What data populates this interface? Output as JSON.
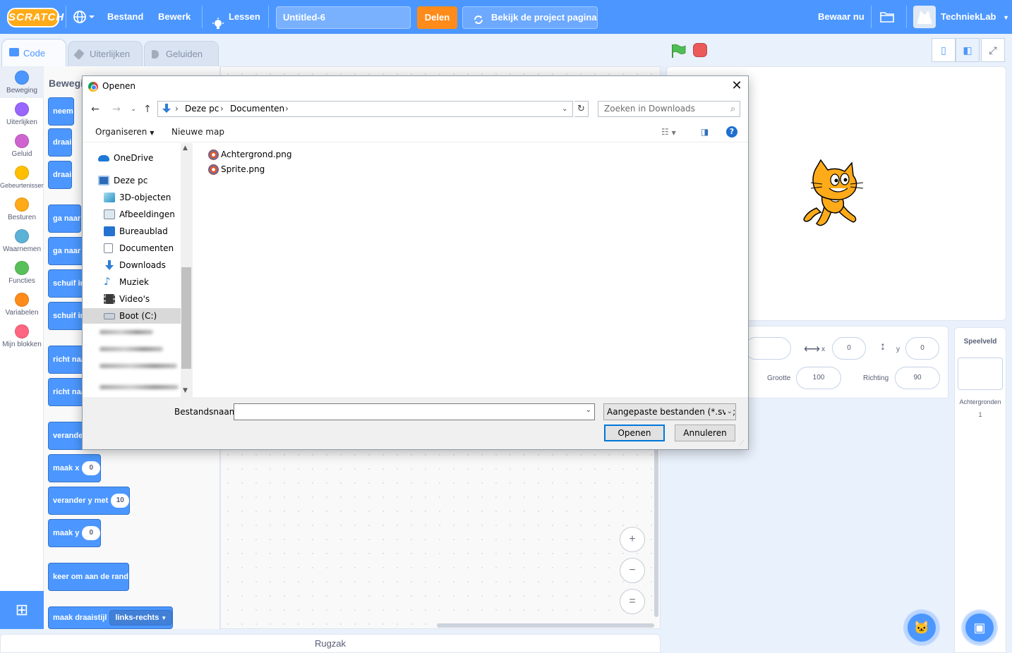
{
  "menubar": {
    "logo": "SCRATCH",
    "file": "Bestand",
    "edit": "Bewerk",
    "tutorials": "Lessen",
    "project_title": "Untitled-6",
    "share": "Delen",
    "see_project": "Bekijk de project pagina",
    "save_now": "Bewaar nu",
    "username": "TechniekLab"
  },
  "tabs": {
    "code": "Code",
    "costumes": "Uiterlijken",
    "sounds": "Geluiden"
  },
  "categories": [
    {
      "label": "Beweging",
      "color": "#4c97ff"
    },
    {
      "label": "Uiterlijken",
      "color": "#9966ff"
    },
    {
      "label": "Geluid",
      "color": "#cf63cf"
    },
    {
      "label": "Gebeurtenissen",
      "color": "#ffbf00"
    },
    {
      "label": "Besturen",
      "color": "#ffab19"
    },
    {
      "label": "Waarnemen",
      "color": "#5cb1d6"
    },
    {
      "label": "Functies",
      "color": "#59c059"
    },
    {
      "label": "Variabelen",
      "color": "#ff8c1a"
    },
    {
      "label": "Mijn blokken",
      "color": "#ff6680"
    }
  ],
  "flyout": {
    "title": "Bewegi",
    "blocks": [
      {
        "text": "neem",
        "slot": ""
      },
      {
        "text": "draai",
        "slot": ""
      },
      {
        "text": "draai",
        "slot": ""
      },
      {
        "text": "ga naar",
        "slot": ""
      },
      {
        "text": "ga naar x",
        "slot": ""
      },
      {
        "text": "schuif in",
        "slot": ""
      },
      {
        "text": "schuif in",
        "slot": ""
      },
      {
        "text": "richt naa",
        "slot": ""
      },
      {
        "text": "richt naa",
        "slot": ""
      },
      {
        "text": "verander",
        "slot": ""
      },
      {
        "text": "maak x",
        "slot": "0"
      },
      {
        "text": "verander y met",
        "slot": "10"
      },
      {
        "text": "maak y",
        "slot": "0"
      },
      {
        "text": "keer om aan de rand",
        "slot": ""
      },
      {
        "text": "maak draaistijl",
        "dropdown": "links-rechts"
      }
    ]
  },
  "workspace": {
    "zoom_in": "+",
    "zoom_out": "−",
    "zoom_reset": "="
  },
  "backpack": "Rugzak",
  "sprite_info": {
    "x_label": "x",
    "x_value": "0",
    "y_label": "y",
    "y_value": "0",
    "size_label": "Grootte",
    "size_value": "100",
    "direction_label": "Richting",
    "direction_value": "90"
  },
  "stage_target": {
    "title": "Speelveld",
    "backdrops_label": "Achtergronden",
    "backdrops_count": "1"
  },
  "dialog": {
    "title": "Openen",
    "address": [
      "Deze pc",
      "Documenten"
    ],
    "search_placeholder": "Zoeken in Downloads",
    "organize": "Organiseren",
    "new_folder": "Nieuwe map",
    "nav_items": [
      {
        "label": "OneDrive",
        "icon": "onedrive-icon",
        "level": "top"
      },
      {
        "label": "Deze pc",
        "icon": "computer-icon",
        "level": "top"
      },
      {
        "label": "3D-objecten",
        "icon": "3d-objects-icon",
        "level": "child"
      },
      {
        "label": "Afbeeldingen",
        "icon": "pictures-icon",
        "level": "child"
      },
      {
        "label": "Bureaublad",
        "icon": "desktop-icon",
        "level": "child"
      },
      {
        "label": "Documenten",
        "icon": "documents-icon",
        "level": "child"
      },
      {
        "label": "Downloads",
        "icon": "downloads-icon",
        "level": "child"
      },
      {
        "label": "Muziek",
        "icon": "music-icon",
        "level": "child"
      },
      {
        "label": "Video's",
        "icon": "videos-icon",
        "level": "child"
      },
      {
        "label": "Boot (C:)",
        "icon": "drive-icon",
        "level": "child",
        "selected": true
      }
    ],
    "files": [
      "Achtergrond.png",
      "Sprite.png"
    ],
    "filename_label": "Bestandsnaam:",
    "filename_value": "",
    "filter": "Aangepaste bestanden (*.svg;*.",
    "open": "Openen",
    "cancel": "Annuleren"
  },
  "colors": {
    "scratch_blue": "#4c97ff",
    "share_orange": "#ff8c1a",
    "motion_block": "#4c97ff",
    "stop_red": "#ec5959",
    "flag_green": "#4cbf56",
    "win_accent": "#0078d7"
  }
}
